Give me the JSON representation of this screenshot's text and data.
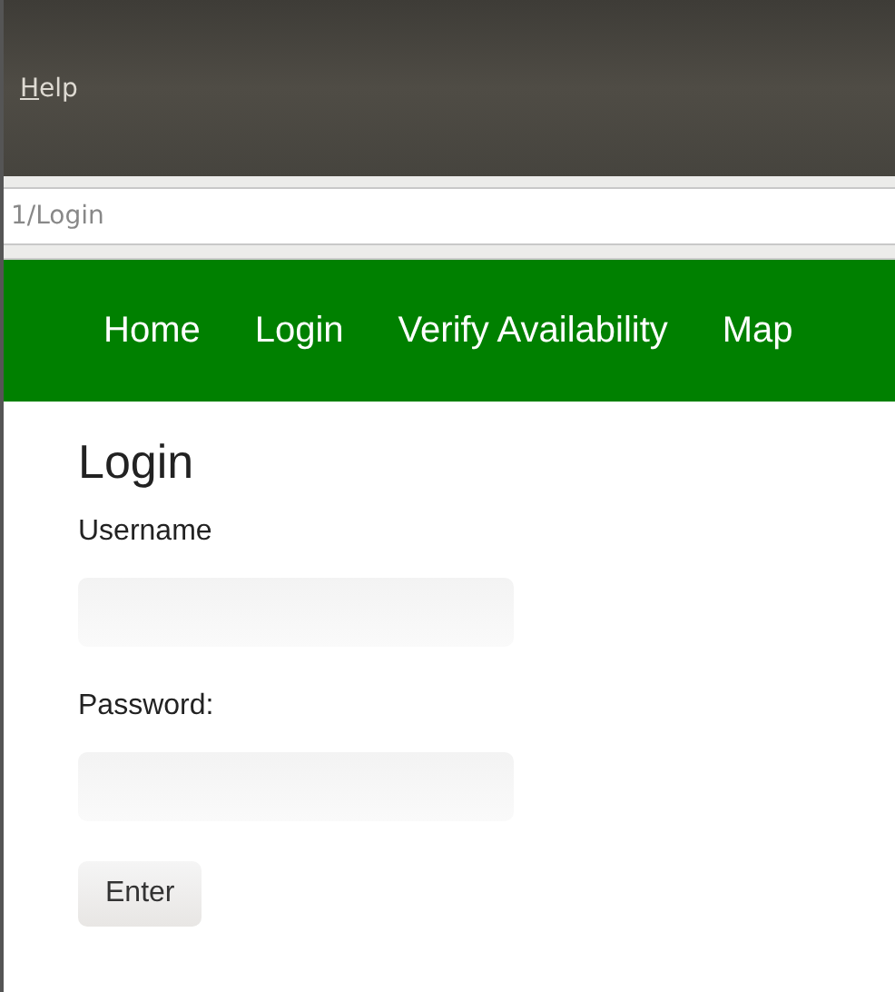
{
  "menu_bar": {
    "items": [
      "Help"
    ]
  },
  "address_bar": {
    "url": "1/Login"
  },
  "nav": {
    "items": [
      "Home",
      "Login",
      "Verify Availability",
      "Map"
    ]
  },
  "form": {
    "title": "Login",
    "fields": [
      {
        "label": "Username"
      },
      {
        "label": "Password:"
      }
    ],
    "button": "Enter"
  }
}
